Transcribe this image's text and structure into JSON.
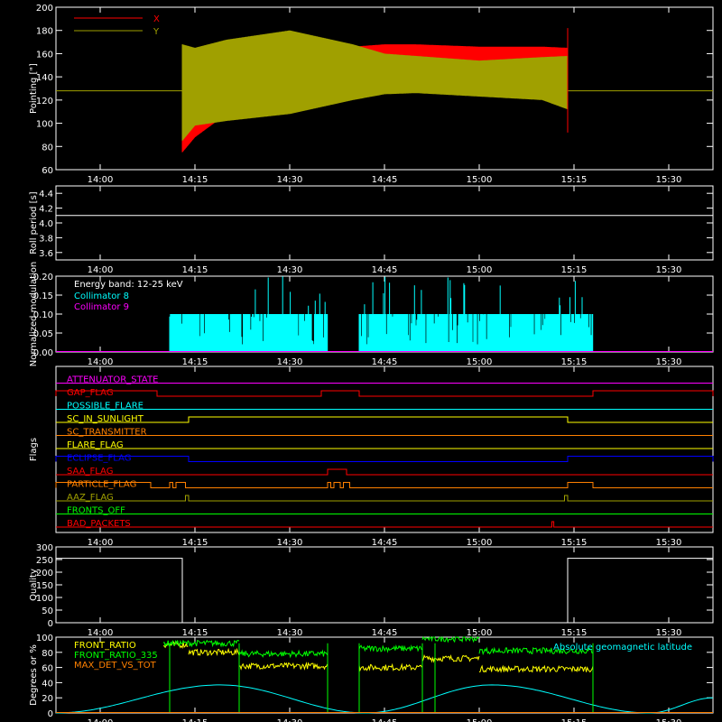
{
  "colors": {
    "background": "#000000",
    "axes": "#ffffff",
    "x_series": "#ff0000",
    "y_series": "#a0a000",
    "cyan": "#00ffff",
    "magenta": "#ff00ff",
    "green": "#00ff00",
    "yellow": "#ffff00",
    "orange": "#ff8000",
    "blue": "#0000ff",
    "olive": "#a0a000"
  },
  "time_ticks": [
    "14:00",
    "14:15",
    "14:30",
    "14:45",
    "15:00",
    "15:15",
    "15:30"
  ],
  "chart_data": [
    {
      "type": "line",
      "id": "pointing",
      "ylabel": "Pointing [\"]",
      "ylim": [
        60,
        200
      ],
      "yticks": [
        60,
        80,
        100,
        120,
        140,
        160,
        180,
        200
      ],
      "xlim": [
        "13:53",
        "15:37"
      ],
      "legend_position": "top-left",
      "series": [
        {
          "name": "X",
          "color": "#ff0000",
          "band": [
            [
              "14:13",
              75,
              165
            ],
            [
              "14:15",
              88,
              160
            ],
            [
              "14:20",
              108,
              168
            ],
            [
              "14:30",
              118,
              170
            ],
            [
              "14:40",
              128,
              166
            ],
            [
              "14:45",
              133,
              168
            ],
            [
              "14:50",
              132,
              168
            ],
            [
              "15:00",
              137,
              166
            ],
            [
              "15:10",
              136,
              166
            ],
            [
              "15:14",
              135,
              165
            ]
          ]
        },
        {
          "name": "Y",
          "color": "#a0a000",
          "band": [
            [
              "14:13",
              85,
              168
            ],
            [
              "14:15",
              98,
              165
            ],
            [
              "14:20",
              102,
              172
            ],
            [
              "14:30",
              108,
              180
            ],
            [
              "14:40",
              120,
              168
            ],
            [
              "14:45",
              125,
              160
            ],
            [
              "14:50",
              126,
              158
            ],
            [
              "15:00",
              123,
              154
            ],
            [
              "15:10",
              120,
              157
            ],
            [
              "15:14",
              112,
              158
            ]
          ],
          "flat": 128
        }
      ]
    },
    {
      "type": "line",
      "id": "roll",
      "ylabel": "Roll period [s]",
      "ylim": [
        3.5,
        4.5
      ],
      "yticks": [
        3.6,
        3.8,
        4.0,
        4.2,
        4.4
      ],
      "series": [
        {
          "name": "",
          "color": "#ffffff",
          "value": 4.1
        }
      ]
    },
    {
      "type": "bar",
      "id": "modulation",
      "ylabel": "Normalized modulation",
      "ylim": [
        0,
        0.2
      ],
      "yticks": [
        0,
        0.05,
        0.1,
        0.15,
        0.2
      ],
      "annotation": "Energy band: 12-25 keV",
      "series": [
        {
          "name": "Collimator 8",
          "color": "#00ffff",
          "segments": [
            [
              "14:11",
              "14:36"
            ],
            [
              "14:41",
              "15:18"
            ]
          ],
          "level": 0.1
        },
        {
          "name": "Collimator 9",
          "color": "#ff00ff",
          "value": 0
        }
      ]
    },
    {
      "type": "line",
      "id": "flags",
      "ylabel": "Flags",
      "flags": [
        {
          "name": "ATTENUATOR_STATE",
          "color": "#ff00ff",
          "on": []
        },
        {
          "name": "GAP_FLAG",
          "color": "#ff0000",
          "on": [
            [
              "13:53",
              "14:09"
            ],
            [
              "14:35",
              "14:41"
            ],
            [
              "15:18",
              "15:37"
            ]
          ]
        },
        {
          "name": "POSSIBLE_FLARE",
          "color": "#00ffff",
          "on": []
        },
        {
          "name": "SC_IN_SUNLIGHT",
          "color": "#ffff00",
          "on": [
            [
              "14:14",
              "15:14"
            ]
          ]
        },
        {
          "name": "SC_TRANSMITTER",
          "color": "#ff8000",
          "on": []
        },
        {
          "name": "FLARE_FLAG",
          "color": "#ffff00",
          "on": []
        },
        {
          "name": "ECLIPSE_FLAG",
          "color": "#0000ff",
          "on": [
            [
              "13:53",
              "14:14"
            ],
            [
              "15:14",
              "15:37"
            ]
          ]
        },
        {
          "name": "SAA_FLAG",
          "color": "#ff0000",
          "on": [
            [
              "14:36",
              "14:39"
            ]
          ]
        },
        {
          "name": "PARTICLE_FLAG",
          "color": "#ff8000",
          "on": [
            [
              "13:53",
              "14:08"
            ],
            [
              "14:11",
              "14:11.5"
            ],
            [
              "14:12",
              "14:13.5"
            ],
            [
              "14:36",
              "14:36.5"
            ],
            [
              "14:37",
              "14:38"
            ],
            [
              "14:38.5",
              "14:39.5"
            ],
            [
              "15:14",
              "15:18"
            ]
          ]
        },
        {
          "name": "AAZ_FLAG",
          "color": "#a0a000",
          "on": [
            [
              "14:13.5",
              "14:14"
            ],
            [
              "15:13.5",
              "15:14"
            ]
          ]
        },
        {
          "name": "FRONTS_OFF",
          "color": "#00ff00",
          "on": []
        },
        {
          "name": "BAD_PACKETS",
          "color": "#ff0000",
          "on": [
            [
              "15:11.5",
              "15:11.8"
            ]
          ]
        }
      ]
    },
    {
      "type": "line",
      "id": "quality",
      "ylabel": "Quality",
      "ylim": [
        0,
        300
      ],
      "yticks": [
        0,
        50,
        100,
        150,
        200,
        250,
        300
      ],
      "series": [
        {
          "name": "",
          "color": "#ffffff",
          "points": [
            [
              "13:53",
              255
            ],
            [
              "14:13",
              255
            ],
            [
              "14:13",
              0
            ],
            [
              "15:14",
              0
            ],
            [
              "15:14",
              255
            ],
            [
              "15:37",
              255
            ]
          ]
        }
      ]
    },
    {
      "type": "line",
      "id": "ratios",
      "ylabel": "Degrees or %",
      "ylim": [
        0,
        100
      ],
      "yticks": [
        0,
        20,
        40,
        60,
        80,
        100
      ],
      "series": [
        {
          "name": "FRONT_RATIO",
          "color": "#ffff00",
          "segments": [
            [
              "14:10",
              "14:14",
              90
            ],
            [
              "14:14",
              "14:22",
              80
            ],
            [
              "14:22",
              "14:36",
              62
            ],
            [
              "14:41",
              "14:51",
              60
            ],
            [
              "14:51",
              "15:00",
              72
            ],
            [
              "15:00",
              "15:18",
              58
            ]
          ]
        },
        {
          "name": "FRONT_RATIO_335",
          "color": "#00ff00",
          "segments": [
            [
              "14:10",
              "14:22",
              92
            ],
            [
              "14:22",
              "14:36",
              78
            ],
            [
              "14:41",
              "14:51",
              85
            ],
            [
              "14:51",
              "15:00",
              98
            ],
            [
              "15:00",
              "15:18",
              82
            ]
          ]
        },
        {
          "name": "MAX_DET_VS_TOT",
          "color": "#ff8000",
          "value": 0
        },
        {
          "name": "Absolute geomagnetic latitude",
          "color": "#00ffff",
          "wave": {
            "min": 0,
            "max": 37,
            "peaks": [
              "14:19",
              "15:02"
            ],
            "troughs": [
              "13:53",
              "14:42",
              "15:27"
            ]
          }
        }
      ]
    }
  ]
}
